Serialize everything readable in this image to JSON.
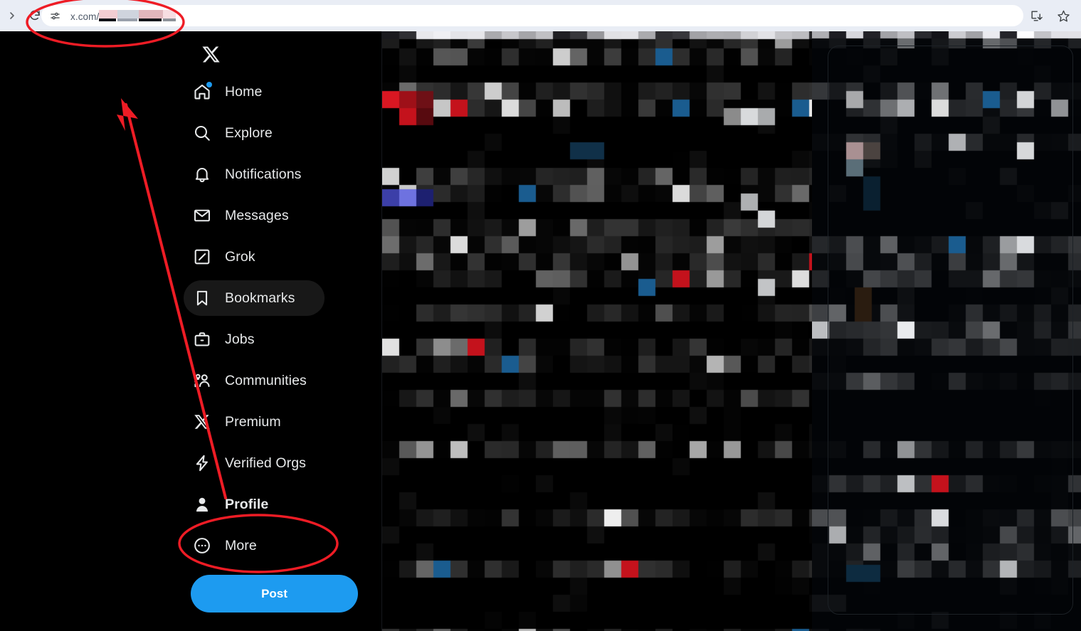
{
  "browser": {
    "reload_label": "Reload",
    "url_prefix": "x.com/",
    "url_redacted": true,
    "install_app_label": "Install app",
    "bookmark_label": "Bookmark this tab",
    "back_label": "Back"
  },
  "sidebar": {
    "logo_label": "X",
    "items": [
      {
        "label": "Home",
        "icon": "home-icon",
        "badge": true,
        "active": false,
        "bold": false
      },
      {
        "label": "Explore",
        "icon": "search-icon",
        "badge": false,
        "active": false,
        "bold": false
      },
      {
        "label": "Notifications",
        "icon": "bell-icon",
        "badge": false,
        "active": false,
        "bold": false
      },
      {
        "label": "Messages",
        "icon": "envelope-icon",
        "badge": false,
        "active": false,
        "bold": false
      },
      {
        "label": "Grok",
        "icon": "grok-icon",
        "badge": false,
        "active": false,
        "bold": false
      },
      {
        "label": "Bookmarks",
        "icon": "bookmark-icon",
        "badge": false,
        "active": true,
        "bold": false
      },
      {
        "label": "Jobs",
        "icon": "briefcase-icon",
        "badge": false,
        "active": false,
        "bold": false
      },
      {
        "label": "Communities",
        "icon": "people-icon",
        "badge": false,
        "active": false,
        "bold": false
      },
      {
        "label": "Premium",
        "icon": "x-icon",
        "badge": false,
        "active": false,
        "bold": false
      },
      {
        "label": "Verified Orgs",
        "icon": "lightning-icon",
        "badge": false,
        "active": false,
        "bold": false
      },
      {
        "label": "Profile",
        "icon": "person-icon",
        "badge": false,
        "active": false,
        "bold": true
      },
      {
        "label": "More",
        "icon": "more-circle-icon",
        "badge": false,
        "active": false,
        "bold": false
      }
    ],
    "post_button": "Post"
  },
  "annotations": {
    "color": "#ee1c25",
    "ellipse_url_label": "highlight-url-bar",
    "ellipse_profile_label": "highlight-profile-item",
    "arrow_label": "arrow-pointing-to-url-bar"
  },
  "content": {
    "redacted": true,
    "note": "Page content is pixelated / censored"
  },
  "colors": {
    "accent_blue": "#1d9bf0",
    "badge_blue": "#1d9bf0",
    "sidebar_text": "#e7e9ea",
    "active_pill": "#181818",
    "chrome_bg": "#e9edf5",
    "omnibox_bg": "#ffffff",
    "annotation_red": "#ee1c25",
    "page_bg": "#000000"
  }
}
